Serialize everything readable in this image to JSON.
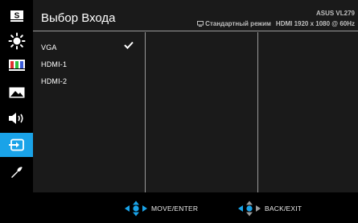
{
  "header": {
    "title": "Выбор Входа",
    "model": "ASUS VL279",
    "mode": "Стандартный режим",
    "resolution": "HDMI 1920 x 1080 @ 60Hz"
  },
  "sidebar": {
    "items": [
      {
        "icon": "splendid-s-icon"
      },
      {
        "icon": "brightness-icon"
      },
      {
        "icon": "color-bars-icon"
      },
      {
        "icon": "image-icon"
      },
      {
        "icon": "sound-icon"
      },
      {
        "icon": "input-select-icon",
        "active": true
      },
      {
        "icon": "wrench-icon"
      }
    ],
    "accent": "#1aa3e8"
  },
  "inputs": [
    {
      "label": "VGA",
      "selected": true
    },
    {
      "label": "HDMI-1",
      "selected": false
    },
    {
      "label": "HDMI-2",
      "selected": false
    }
  ],
  "footer": {
    "move_label": "MOVE/ENTER",
    "back_label": "BACK/EXIT"
  }
}
